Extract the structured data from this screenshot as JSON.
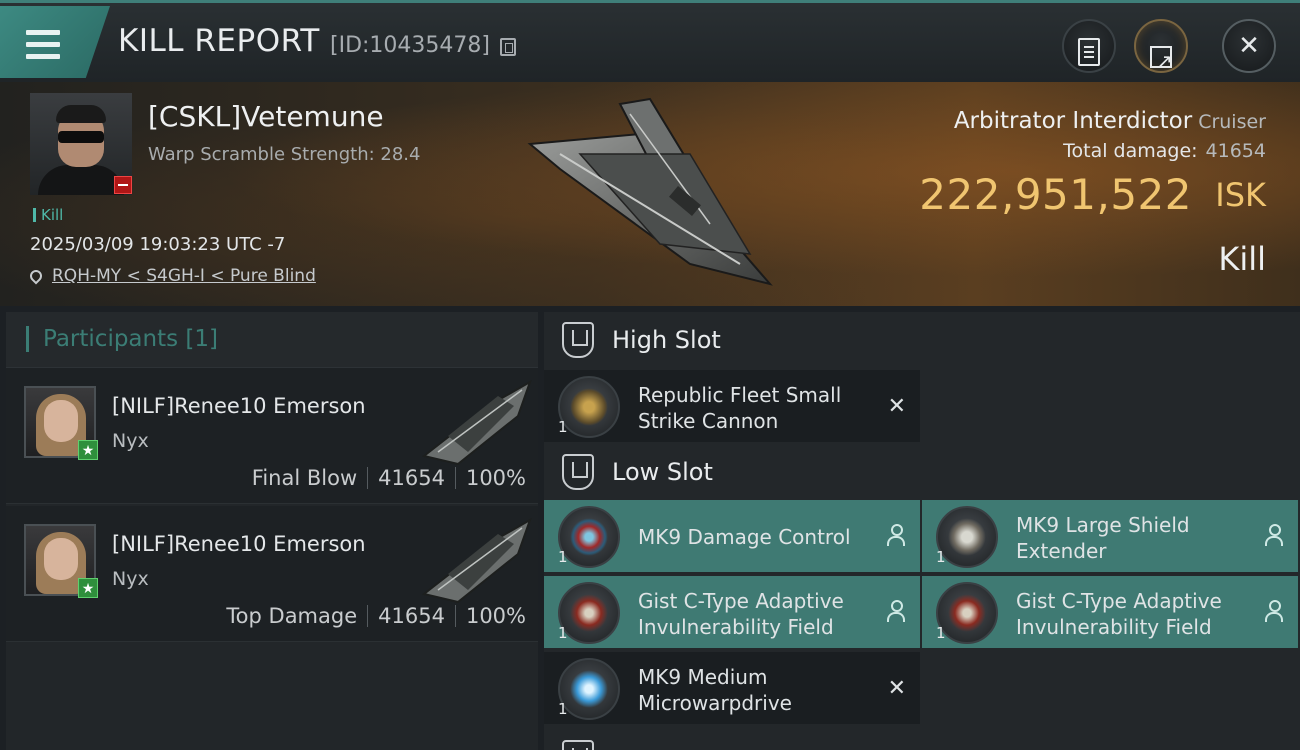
{
  "header": {
    "title": "KILL REPORT",
    "report_id": "[ID:10435478]"
  },
  "victim": {
    "name": "[CSKL]Vetemune",
    "warp_scramble": "Warp Scramble Strength: 28.4",
    "tag": "Kill",
    "timestamp": "2025/03/09 19:03:23 UTC -7",
    "location": "RQH-MY < S4GH-I < Pure Blind",
    "ship_name": "Arbitrator Interdictor",
    "ship_class": "Cruiser",
    "total_damage_label": "Total damage:",
    "total_damage": "41654",
    "isk_value": "222,951,522",
    "isk_unit": "ISK",
    "result": "Kill"
  },
  "participants": {
    "title": "Participants [1]",
    "items": [
      {
        "name": "[NILF]Renee10 Emerson",
        "ship": "Nyx",
        "role": "Final Blow",
        "damage": "41654",
        "percent": "100%"
      },
      {
        "name": "[NILF]Renee10 Emerson",
        "ship": "Nyx",
        "role": "Top Damage",
        "damage": "41654",
        "percent": "100%"
      }
    ]
  },
  "fitting": {
    "high_slot": {
      "label": "High Slot",
      "modules": [
        {
          "name": "Republic Fleet Small Strike Cannon",
          "qty": "1",
          "status": "✕"
        }
      ]
    },
    "low_slot": {
      "label": "Low Slot",
      "modules": [
        {
          "name": "MK9 Damage Control",
          "qty": "1"
        },
        {
          "name": "MK9 Large Shield Extender",
          "qty": "1"
        },
        {
          "name": "Gist C-Type Adaptive Invulnerability Field",
          "qty": "1"
        },
        {
          "name": "Gist C-Type Adaptive Invulnerability Field",
          "qty": "1"
        },
        {
          "name": "MK9 Medium Microwarpdrive",
          "qty": "1",
          "status": "✕"
        }
      ]
    }
  },
  "colors": {
    "accent_teal": "#3f7a73",
    "isk_gold": "#f0c570",
    "kill_tag": "#4fb8a8"
  }
}
